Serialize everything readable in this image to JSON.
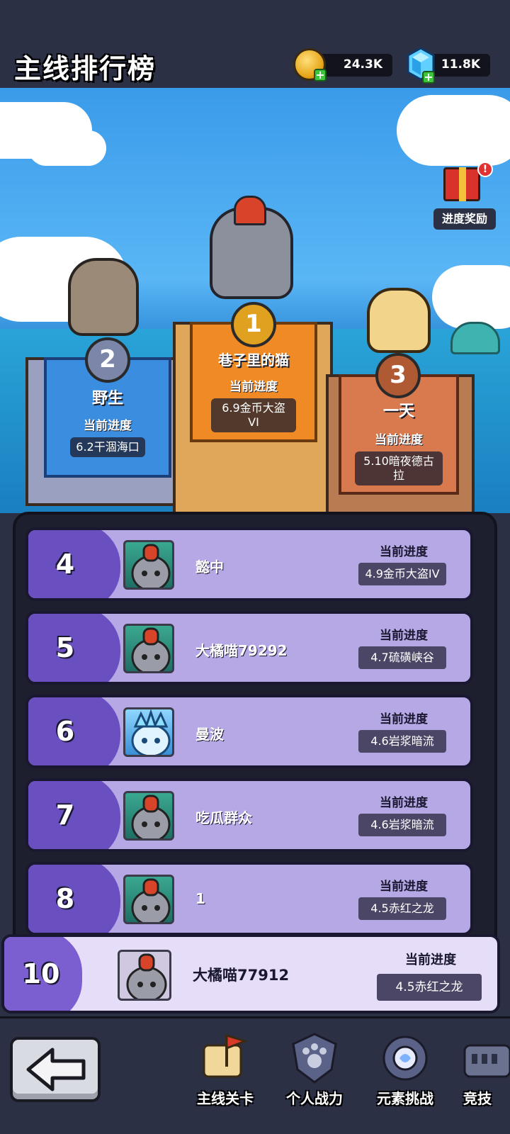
{
  "header": {
    "title": "主线排行榜",
    "coins": "24.3K",
    "gems": "11.8K"
  },
  "gift": {
    "label": "进度奖励"
  },
  "podium": {
    "first": {
      "rank": "1",
      "name": "巷子里的猫",
      "progress_label": "当前进度",
      "progress": "6.9金币大盗VI"
    },
    "second": {
      "rank": "2",
      "name": "野生",
      "progress_label": "当前进度",
      "progress": "6.2干涸海口"
    },
    "third": {
      "rank": "3",
      "name": "一天",
      "progress_label": "当前进度",
      "progress": "5.10暗夜德古拉"
    }
  },
  "list": [
    {
      "rank": "4",
      "name": "懿中",
      "progress_label": "当前进度",
      "progress": "4.9金币大盗IV",
      "avatar": "cat-helmet"
    },
    {
      "rank": "5",
      "name": "大橘喵79292",
      "progress_label": "当前进度",
      "progress": "4.7硫磺峡谷",
      "avatar": "cat-helmet"
    },
    {
      "rank": "6",
      "name": "曼波",
      "progress_label": "当前进度",
      "progress": "4.6岩浆暗流",
      "avatar": "ice-cat"
    },
    {
      "rank": "7",
      "name": "吃瓜群众",
      "progress_label": "当前进度",
      "progress": "4.6岩浆暗流",
      "avatar": "cat-helmet"
    },
    {
      "rank": "8",
      "name": "1",
      "progress_label": "当前进度",
      "progress": "4.5赤红之龙",
      "avatar": "cat-helmet"
    }
  ],
  "me": {
    "rank": "10",
    "name": "大橘喵77912",
    "progress_label": "当前进度",
    "progress": "4.5赤红之龙"
  },
  "nav": {
    "items": [
      {
        "label": "主线关卡",
        "icon": "map-flag-icon"
      },
      {
        "label": "个人战力",
        "icon": "paw-shield-icon"
      },
      {
        "label": "元素挑战",
        "icon": "element-orb-icon"
      },
      {
        "label": "竞技",
        "icon": "colosseum-icon"
      }
    ]
  }
}
